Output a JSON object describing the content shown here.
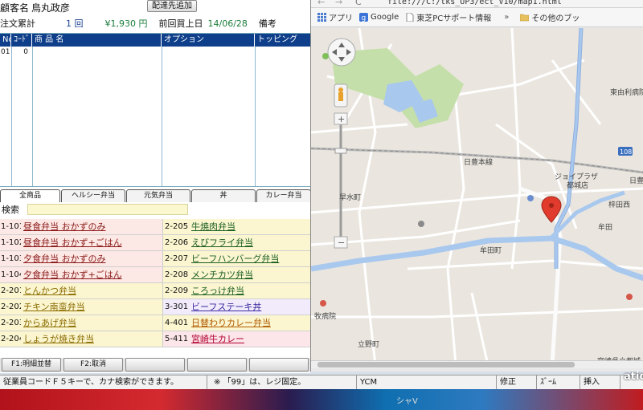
{
  "customer": {
    "name_label": "顧客名",
    "name_value": "鳥丸政彦",
    "add_delivery_button": "配達先追加",
    "order_total_label": "注文累計",
    "order_count": "1 回",
    "order_amount": "¥1,930 円",
    "last_purchase_label": "前回買上日",
    "last_purchase_date": "14/06/28",
    "notes_label": "備考"
  },
  "order_grid": {
    "headers": [
      "No",
      "ｺｰﾄﾞ",
      "商 品 名",
      "オプション",
      "トッピング"
    ],
    "rows": [
      [
        "01",
        "0",
        "",
        "",
        ""
      ]
    ]
  },
  "tabs": [
    "全商品",
    "ヘルシー弁当",
    "元気弁当",
    "丼",
    "カレー弁当"
  ],
  "search_label": "検索",
  "menu_items": [
    {
      "code": "1-101",
      "name": "昼食弁当 おかずのみ",
      "code2": "2-205",
      "name2": "牛焼肉弁当"
    },
    {
      "code": "1-102",
      "name": "昼食弁当 おかず+ごはん",
      "code2": "2-206",
      "name2": "えびフライ弁当"
    },
    {
      "code": "1-103",
      "name": "夕食弁当 おかずのみ",
      "code2": "2-207",
      "name2": "ビーフハンバーグ弁当"
    },
    {
      "code": "1-104",
      "name": "夕食弁当 おかず+ごはん",
      "code2": "2-208",
      "name2": "メンチカツ弁当"
    },
    {
      "code": "2-201",
      "name": "とんかつ弁当",
      "code2": "2-209",
      "name2": "ころっけ弁当"
    },
    {
      "code": "2-202",
      "name": "チキン南蛮弁当",
      "code2": "3-301",
      "name2": "ビーフステーキ丼"
    },
    {
      "code": "2-203",
      "name": "からあげ弁当",
      "code2": "4-401",
      "name2": "日替わりカレー弁当"
    },
    {
      "code": "2-204",
      "name": "しょうが焼き弁当",
      "code2": "5-411",
      "name2": "宮崎牛カレー"
    }
  ],
  "function_keys": [
    "F1:明細並替",
    "F2:取消",
    "",
    "",
    ""
  ],
  "status": {
    "message": "従業員コードＦ５キーで、カナ検索ができます。",
    "message2": "※ 「99」は、レジ固定。",
    "ycm": "YCM",
    "mode": "修正",
    "zoom": "ｽﾞｰﾑ",
    "insert": "挿入"
  },
  "taskbar": {
    "label": "シャV",
    "corner": "atio"
  },
  "browser": {
    "url": "file:///C:/tks_UP3/ect_V10/map1.html",
    "bookmarks": [
      "アプリ",
      "Google",
      "東芝PCサポート情報",
      "その他のブッ"
    ],
    "overflow": "»"
  },
  "map": {
    "labels": [
      "日豊本線",
      "ジョイプラザ",
      "都城店",
      "東由利病院",
      "早水町",
      "牟田町",
      "梓田西",
      "牟田",
      "牧病院",
      "立野町",
      "日豊",
      "108",
      "宮崎県立都城"
    ]
  },
  "colors": {
    "grid_header": "#0f3f8a",
    "menu_peach": "#fce8e4",
    "menu_yellow": "#fbf6cf",
    "menu_lavender": "#f1ebfb",
    "menu_pink": "#fde6ea",
    "river": "#a9c8ee",
    "park": "#c5dfaa",
    "pin": "#e03b2c"
  }
}
